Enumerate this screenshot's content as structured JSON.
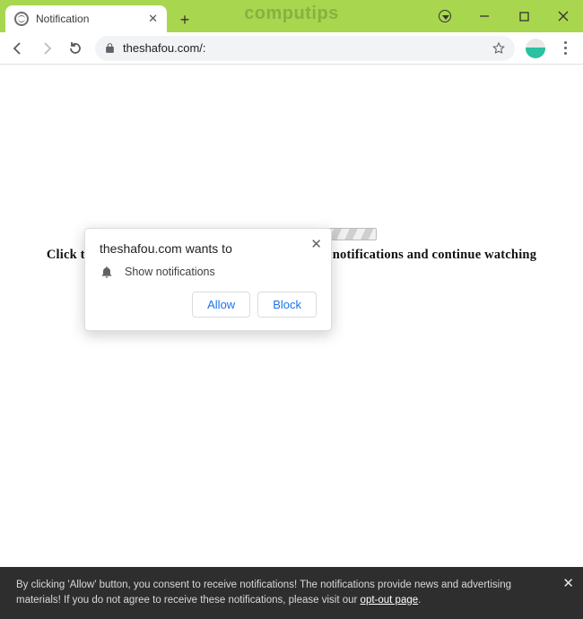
{
  "window": {
    "watermark": "computips"
  },
  "tab": {
    "title": "Notification"
  },
  "address": {
    "url": "theshafou.com/:"
  },
  "popup": {
    "title": "theshafou.com wants to",
    "permission_label": "Show notifications",
    "allow_label": "Allow",
    "block_label": "Block"
  },
  "page": {
    "instruction": "Click the «Allow» button to subscribe to the push notifications and continue watching"
  },
  "footer": {
    "text_before": "By clicking 'Allow' button, you consent to receive notifications! The notifications provide news and advertising materials! If you do not agree to receive these notifications, please visit our ",
    "link_label": "opt-out page",
    "text_after": "."
  }
}
